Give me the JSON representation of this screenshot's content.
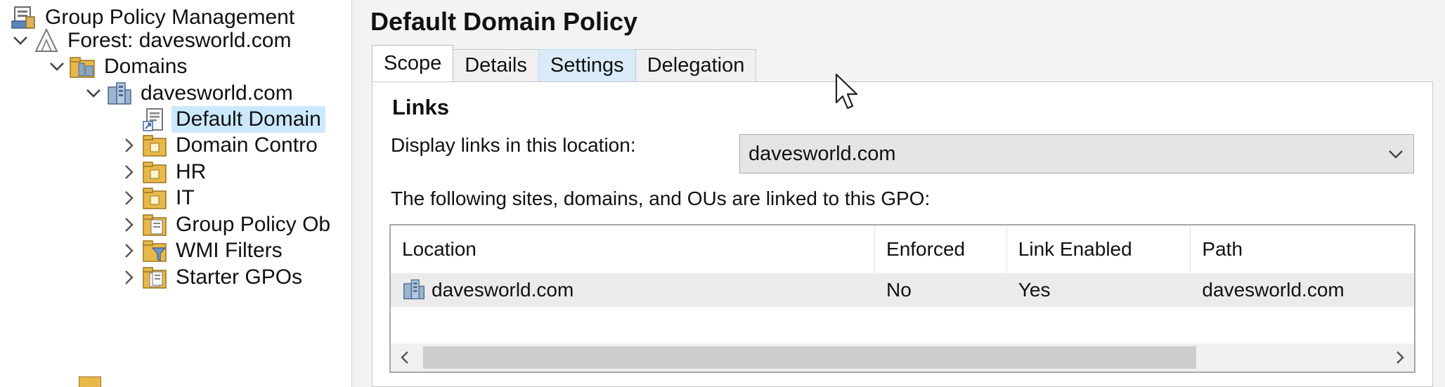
{
  "tree": {
    "nodes": [
      {
        "label": "Group Policy Management",
        "icon": "gpmc-console-icon",
        "expander": "none"
      },
      {
        "label": "Forest: davesworld.com",
        "icon": "forest-icon",
        "expander": "expanded"
      },
      {
        "label": "Domains",
        "icon": "domains-icon",
        "expander": "expanded"
      },
      {
        "label": "davesworld.com",
        "icon": "domain-icon",
        "expander": "expanded"
      },
      {
        "label": "Default Domain",
        "icon": "gpo-link-icon",
        "expander": "none",
        "selected": true
      },
      {
        "label": "Domain Contro",
        "icon": "ou-folder-icon",
        "expander": "collapsed"
      },
      {
        "label": "HR",
        "icon": "ou-folder-icon",
        "expander": "collapsed"
      },
      {
        "label": "IT",
        "icon": "ou-folder-icon",
        "expander": "collapsed"
      },
      {
        "label": "Group Policy Ob",
        "icon": "gpo-container-icon",
        "expander": "collapsed"
      },
      {
        "label": "WMI Filters",
        "icon": "wmi-filter-folder-icon",
        "expander": "collapsed"
      },
      {
        "label": "Starter GPOs",
        "icon": "starter-gpo-folder-icon",
        "expander": "collapsed"
      }
    ]
  },
  "main": {
    "title": "Default Domain Policy",
    "tabs": [
      {
        "label": "Scope",
        "state": "active"
      },
      {
        "label": "Details",
        "state": "normal"
      },
      {
        "label": "Settings",
        "state": "hover"
      },
      {
        "label": "Delegation",
        "state": "normal"
      }
    ],
    "links_heading": "Links",
    "display_label": "Display links in this location:",
    "location_value": "davesworld.com",
    "linked_caption": "The following sites, domains, and OUs are linked to this GPO:",
    "table": {
      "columns": [
        "Location",
        "Enforced",
        "Link Enabled",
        "Path"
      ],
      "rows": [
        {
          "location": "davesworld.com",
          "enforced": "No",
          "link_enabled": "Yes",
          "path": "davesworld.com",
          "icon": "domain-icon"
        }
      ]
    }
  },
  "colors": {
    "selection": "#cce8ff",
    "tab_hover": "#d9ebf9",
    "row_bg": "#ebebeb",
    "folder": "#e8b94a"
  }
}
